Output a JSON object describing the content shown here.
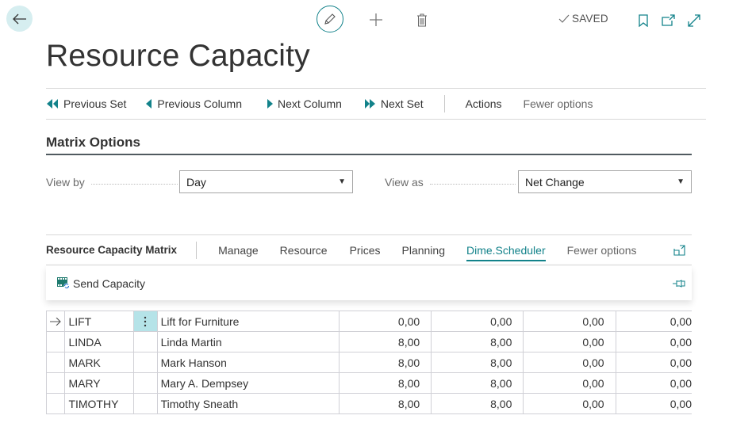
{
  "header": {
    "back_icon": "arrow-left-icon",
    "edit_icon": "pencil-icon",
    "new_icon": "plus-icon",
    "delete_icon": "trash-icon",
    "saved_label": "SAVED",
    "saved_icon": "checkmark-icon",
    "bookmark_icon": "bookmark-icon",
    "open_new_window_icon": "open-in-new-window-icon",
    "expand_icon": "expand-icon"
  },
  "page": {
    "title": "Resource Capacity"
  },
  "action_bar": {
    "items": [
      {
        "label": "Previous Set",
        "icon": "double-left-triangle-icon"
      },
      {
        "label": "Previous Column",
        "icon": "left-triangle-icon"
      },
      {
        "label": "Next Column",
        "icon": "right-triangle-icon"
      },
      {
        "label": "Next Set",
        "icon": "double-right-triangle-icon"
      }
    ],
    "actions_label": "Actions",
    "fewer_options_label": "Fewer options"
  },
  "matrix_options": {
    "title": "Matrix Options",
    "view_by": {
      "label": "View by",
      "value": "Day"
    },
    "view_as": {
      "label": "View as",
      "value": "Net Change"
    }
  },
  "subpage": {
    "title": "Resource Capacity Matrix",
    "tabs": [
      {
        "label": "Manage",
        "active": false
      },
      {
        "label": "Resource",
        "active": false
      },
      {
        "label": "Prices",
        "active": false
      },
      {
        "label": "Planning",
        "active": false
      },
      {
        "label": "Dime.Scheduler",
        "active": true
      },
      {
        "label": "Fewer options",
        "active": false
      }
    ],
    "expand_icon": "open-full-page-icon",
    "dropdown": {
      "items": [
        {
          "label": "Send Capacity",
          "icon": "send-capacity-icon"
        }
      ],
      "pin_icon": "pin-icon"
    }
  },
  "grid": {
    "current_row_indicator": "arrow-right-icon",
    "rows": [
      {
        "no": "LIFT",
        "name": "Lift for Furniture",
        "values": [
          "0,00",
          "0,00",
          "0,00",
          "0,00"
        ],
        "current": true
      },
      {
        "no": "LINDA",
        "name": "Linda Martin",
        "values": [
          "8,00",
          "8,00",
          "0,00",
          "0,00"
        ],
        "current": false
      },
      {
        "no": "MARK",
        "name": "Mark Hanson",
        "values": [
          "8,00",
          "8,00",
          "0,00",
          "0,00"
        ],
        "current": false
      },
      {
        "no": "MARY",
        "name": "Mary A. Dempsey",
        "values": [
          "8,00",
          "8,00",
          "0,00",
          "0,00"
        ],
        "current": false
      },
      {
        "no": "TIMOTHY",
        "name": "Timothy Sneath",
        "values": [
          "8,00",
          "8,00",
          "0,00",
          "0,00"
        ],
        "current": false
      }
    ]
  }
}
